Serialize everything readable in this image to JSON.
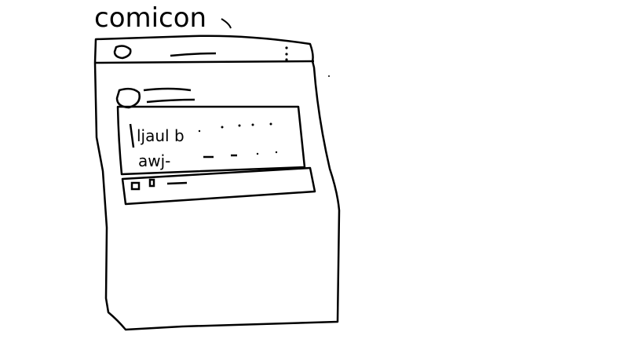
{
  "sketch": {
    "title": "comicon",
    "post_line_1": "ljaul b",
    "post_line_2": "awj-"
  },
  "colors": {
    "ink": "#000000",
    "paper": "#ffffff"
  },
  "icons": {
    "header_avatar": "circle-avatar-icon",
    "menu": "kebab-menu-icon",
    "post_avatar": "circle-avatar-icon",
    "action_1": "square-icon",
    "action_2": "small-square-icon"
  }
}
